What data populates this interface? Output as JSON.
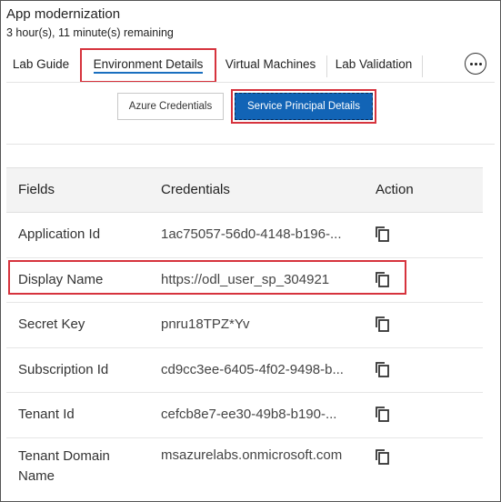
{
  "app": {
    "title": "App modernization",
    "time_remaining": "3 hour(s), 11 minute(s) remaining"
  },
  "tabs": [
    {
      "label": "Lab Guide",
      "active": false
    },
    {
      "label": "Environment Details",
      "active": true
    },
    {
      "label": "Virtual Machines",
      "active": false
    },
    {
      "label": "Lab Validation",
      "active": false
    }
  ],
  "more_icon": "more-horizontal-icon",
  "buttons": {
    "azure_credentials": "Azure Credentials",
    "service_principal": "Service Principal Details"
  },
  "table": {
    "headers": {
      "fields": "Fields",
      "credentials": "Credentials",
      "action": "Action"
    },
    "rows": [
      {
        "field": "Application Id",
        "value": "1ac75057-56d0-4148-b196-...",
        "action_icon": "copy-icon"
      },
      {
        "field": "Display Name",
        "value": "https://odl_user_sp_304921",
        "action_icon": "copy-icon"
      },
      {
        "field": "Secret Key",
        "value": "pnru18TPZ*Yv",
        "action_icon": "copy-icon"
      },
      {
        "field": "Subscription Id",
        "value": "cd9cc3ee-6405-4f02-9498-b...",
        "action_icon": "copy-icon"
      },
      {
        "field": "Tenant Id",
        "value": "cefcb8e7-ee30-49b8-b190-...",
        "action_icon": "copy-icon"
      },
      {
        "field": "Tenant Domain Name",
        "value": "msazurelabs.onmicrosoft.com",
        "action_icon": "copy-icon"
      }
    ]
  },
  "colors": {
    "accent_blue": "#1264b6",
    "highlight_red": "#d6333d",
    "header_bg": "#f3f3f3"
  }
}
